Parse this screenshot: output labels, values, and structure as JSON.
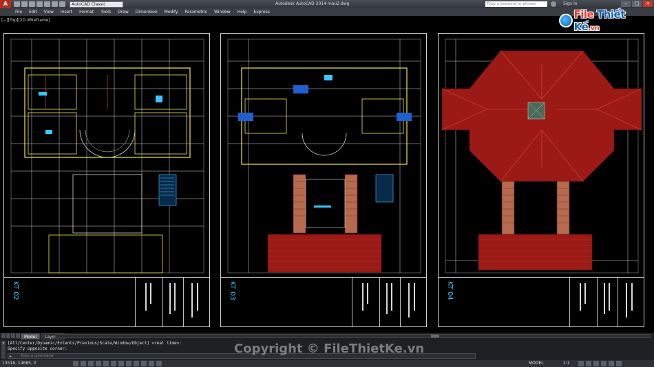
{
  "titlebar": {
    "app_button": "A",
    "workspace": "AutoCAD Classic",
    "title": "Autodesk AutoCAD 2014    mau2.dwg",
    "search_placeholder": "Type a keyword or phrase",
    "sign_in": "Sign In"
  },
  "logo": {
    "word1": "File",
    "word2": "Thiết Kế",
    "suffix": ".vn"
  },
  "menu": [
    "File",
    "Edit",
    "View",
    "Insert",
    "Format",
    "Tools",
    "Draw",
    "Dimension",
    "Modify",
    "Parametric",
    "Window",
    "Help",
    "Express"
  ],
  "viewport": {
    "label": "[−][Top][2D Wireframe]",
    "sheets": [
      {
        "id": "KT 02",
        "label": "KT 02"
      },
      {
        "id": "KT 03",
        "label": "KT 03"
      },
      {
        "id": "KT 04",
        "label": "KT 04"
      }
    ]
  },
  "tabs": [
    "Model",
    "Layout1"
  ],
  "command": {
    "history_1": "[All/Center/Dynamic/Extents/Previous/Scale/Window/Object] <real time>:",
    "history_2": "Specify opposite corner:",
    "placeholder": "Type a command"
  },
  "watermark": "Copyright © FileThietKe.vn",
  "status": {
    "coords": "13516, 14685, 0",
    "model": "MODEL",
    "scale": "1:1"
  },
  "colors": {
    "roof": "#9b1a16",
    "column": "#b66a4e",
    "cyan": "#36c9ff",
    "yellow": "#f2e94d"
  }
}
